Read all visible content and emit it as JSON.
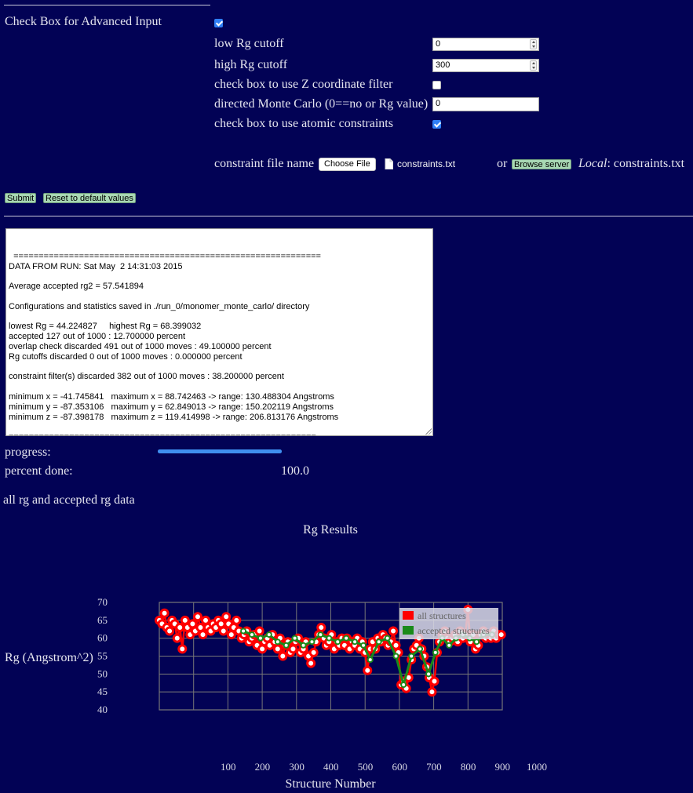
{
  "form": {
    "advanced_label": "Check Box for Advanced Input",
    "advanced_checked": true,
    "fields": {
      "low_rg_label": "low Rg cutoff",
      "low_rg_value": "0",
      "high_rg_label": "high Rg cutoff",
      "high_rg_value": "300",
      "z_filter_label": "check box to use Z coordinate filter",
      "z_filter_checked": false,
      "directed_mc_label": "directed Monte Carlo (0==no or Rg value)",
      "directed_mc_value": "0",
      "constraints_label": "check box to use atomic constraints",
      "constraints_checked": true
    },
    "constraint_file": {
      "label": "constraint file name",
      "choose_label": "Choose File",
      "file_icon": "document-icon",
      "chosen_file": "constraints.txt",
      "or_label": "or",
      "browse_label": "Browse server",
      "local_label": "Local",
      "local_value": ": constraints.txt"
    },
    "submit_label": "Submit",
    "reset_label": "Reset to default values"
  },
  "output": {
    "text": "=============================================================\nDATA FROM RUN: Sat May  2 14:31:03 2015\n\nAverage accepted rg2 = 57.541894\n\nConfigurations and statistics saved in ./run_0/monomer_monte_carlo/ directory\n\nlowest Rg = 44.224827     highest Rg = 68.399032\naccepted 127 out of 1000 : 12.700000 percent\noverlap check discarded 491 out of 1000 moves : 49.100000 percent\nRg cutoffs discarded 0 out of 1000 moves : 0.000000 percent\n\nconstraint filter(s) discarded 382 out of 1000 moves : 38.200000 percent\n\nminimum x = -41.745841   maximum x = 88.742463 -> range: 130.488304 Angstroms\nminimum y = -87.353106   maximum y = 62.849013 -> range: 150.202119 Angstroms\nminimum z = -87.398178   maximum z = 119.414998 -> range: 206.813176 Angstroms\n\n============================================================="
  },
  "status": {
    "progress_label": "progress:",
    "progress_fraction": 1.0,
    "percent_label": "percent done:",
    "percent_value": "100.0",
    "plot_heading": "all rg and accepted rg data"
  },
  "colors": {
    "background": "#020255",
    "all_structures": "#ff0000",
    "accepted_structures": "#1a8a1a",
    "progress": "#3f8ff0"
  },
  "chart_data": {
    "type": "line",
    "title": "Rg Results",
    "xlabel": "Structure Number",
    "ylabel": "Rg (Angstrom^2)",
    "xlim": [
      0,
      1000
    ],
    "ylim": [
      40,
      70
    ],
    "x_ticks": [
      "100",
      "200",
      "300",
      "400",
      "500",
      "600",
      "700",
      "800",
      "900",
      "1000"
    ],
    "y_ticks": [
      "70",
      "65",
      "60",
      "55",
      "50",
      "45",
      "40"
    ],
    "grid": true,
    "legend_position": "top-right",
    "series": [
      {
        "name": "all structures",
        "color": "#ff0000",
        "points": [
          [
            0,
            65
          ],
          [
            8,
            64
          ],
          [
            15,
            67
          ],
          [
            22,
            63
          ],
          [
            30,
            62
          ],
          [
            37,
            65
          ],
          [
            45,
            64
          ],
          [
            52,
            60
          ],
          [
            60,
            63
          ],
          [
            67,
            57
          ],
          [
            75,
            65
          ],
          [
            82,
            63
          ],
          [
            90,
            61
          ],
          [
            97,
            64
          ],
          [
            105,
            62
          ],
          [
            112,
            66
          ],
          [
            120,
            63
          ],
          [
            127,
            61
          ],
          [
            135,
            65
          ],
          [
            142,
            63
          ],
          [
            150,
            62
          ],
          [
            157,
            64
          ],
          [
            165,
            63
          ],
          [
            172,
            65
          ],
          [
            180,
            64
          ],
          [
            187,
            62
          ],
          [
            195,
            66
          ],
          [
            202,
            64
          ],
          [
            210,
            61
          ],
          [
            217,
            63
          ],
          [
            225,
            65
          ],
          [
            232,
            62
          ],
          [
            240,
            60
          ],
          [
            247,
            61
          ],
          [
            255,
            62
          ],
          [
            262,
            59
          ],
          [
            270,
            60
          ],
          [
            277,
            61
          ],
          [
            285,
            58
          ],
          [
            292,
            62
          ],
          [
            300,
            57
          ],
          [
            307,
            59
          ],
          [
            315,
            60
          ],
          [
            322,
            58
          ],
          [
            330,
            61
          ],
          [
            337,
            59
          ],
          [
            345,
            57
          ],
          [
            352,
            60
          ],
          [
            360,
            55
          ],
          [
            367,
            58
          ],
          [
            375,
            59
          ],
          [
            382,
            56
          ],
          [
            390,
            57
          ],
          [
            397,
            59
          ],
          [
            405,
            60
          ],
          [
            412,
            56
          ],
          [
            420,
            57
          ],
          [
            427,
            59
          ],
          [
            435,
            55
          ],
          [
            442,
            53
          ],
          [
            450,
            56
          ],
          [
            457,
            59
          ],
          [
            465,
            61
          ],
          [
            472,
            63
          ],
          [
            480,
            60
          ],
          [
            487,
            58
          ],
          [
            495,
            59
          ],
          [
            502,
            61
          ],
          [
            510,
            57
          ],
          [
            517,
            59
          ],
          [
            525,
            58
          ],
          [
            532,
            60
          ],
          [
            540,
            58
          ],
          [
            547,
            60
          ],
          [
            555,
            57
          ],
          [
            562,
            59
          ],
          [
            570,
            58
          ],
          [
            577,
            60
          ],
          [
            585,
            57
          ],
          [
            592,
            59
          ],
          [
            600,
            56
          ],
          [
            607,
            51
          ],
          [
            615,
            57
          ],
          [
            622,
            59
          ],
          [
            630,
            57
          ],
          [
            637,
            60
          ],
          [
            645,
            59
          ],
          [
            652,
            61
          ],
          [
            660,
            60
          ],
          [
            667,
            58
          ],
          [
            675,
            59
          ],
          [
            682,
            62
          ],
          [
            690,
            58
          ],
          [
            697,
            56
          ],
          [
            705,
            47
          ],
          [
            712,
            48
          ],
          [
            720,
            46
          ],
          [
            727,
            49
          ],
          [
            735,
            54
          ],
          [
            742,
            57
          ],
          [
            750,
            58
          ],
          [
            757,
            60
          ],
          [
            765,
            57
          ],
          [
            772,
            55
          ],
          [
            780,
            52
          ],
          [
            787,
            49
          ],
          [
            795,
            45
          ],
          [
            802,
            48
          ],
          [
            810,
            56
          ],
          [
            817,
            59
          ],
          [
            825,
            61
          ],
          [
            832,
            62
          ],
          [
            840,
            60
          ],
          [
            847,
            59
          ],
          [
            855,
            60
          ],
          [
            862,
            61
          ],
          [
            870,
            59
          ],
          [
            877,
            62
          ],
          [
            885,
            60
          ],
          [
            892,
            61
          ],
          [
            900,
            68
          ],
          [
            907,
            59
          ],
          [
            915,
            61
          ],
          [
            922,
            57
          ],
          [
            930,
            58
          ],
          [
            937,
            61
          ],
          [
            945,
            62
          ],
          [
            952,
            60
          ],
          [
            960,
            61
          ],
          [
            967,
            60
          ],
          [
            975,
            62
          ],
          [
            982,
            60
          ],
          [
            990,
            61
          ],
          [
            997,
            61
          ]
        ]
      },
      {
        "name": "accepted structures",
        "color": "#1a8a1a",
        "points": [
          [
            245,
            62
          ],
          [
            270,
            61
          ],
          [
            295,
            60
          ],
          [
            320,
            61
          ],
          [
            345,
            59
          ],
          [
            370,
            58
          ],
          [
            395,
            60
          ],
          [
            420,
            58
          ],
          [
            445,
            59
          ],
          [
            470,
            61
          ],
          [
            495,
            60
          ],
          [
            520,
            59
          ],
          [
            545,
            60
          ],
          [
            570,
            59
          ],
          [
            595,
            58
          ],
          [
            615,
            54
          ],
          [
            640,
            59
          ],
          [
            665,
            60
          ],
          [
            690,
            55
          ],
          [
            712,
            47
          ],
          [
            735,
            55
          ],
          [
            760,
            57
          ],
          [
            785,
            50
          ],
          [
            805,
            56
          ],
          [
            825,
            60
          ],
          [
            845,
            58
          ],
          [
            865,
            60
          ],
          [
            885,
            61
          ],
          [
            905,
            60
          ],
          [
            925,
            59
          ],
          [
            945,
            61
          ],
          [
            970,
            61
          ]
        ]
      }
    ]
  }
}
